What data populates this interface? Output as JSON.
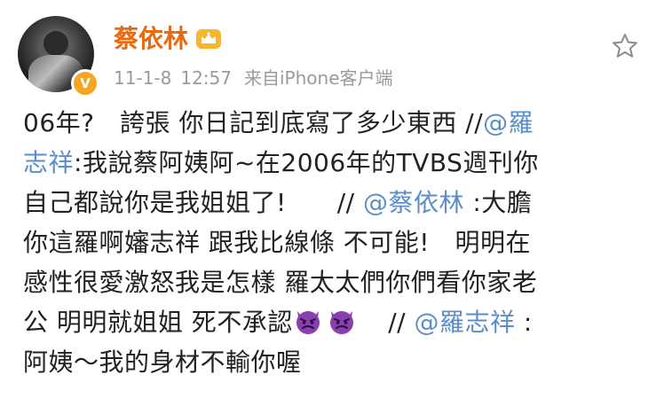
{
  "post": {
    "username": "蔡依林",
    "date": "11-1-8",
    "time": "12:57",
    "source": "来自iPhone客户端",
    "verified_badge": "V",
    "colors": {
      "username": "#e86b10",
      "mention": "#5b8ec9",
      "text": "#222222",
      "meta": "#9a9a9a",
      "badge": "#f5a623",
      "emoji_devil": "#8a3fb0"
    },
    "icons": [
      "crown-icon",
      "star-icon",
      "devil-emoji"
    ]
  },
  "content": {
    "line1_text": "06年?　誇張 你日記到底寫了多少東西 //",
    "mention1_part1": "@羅",
    "mention1_part2": "志祥",
    "line2_text": ":我說蔡阿姨阿~在2006年的TVBS週刊你",
    "line3_text": "自己都說你是我姐姐了!　　//",
    "mention2": "@蔡依林",
    "line3_after": ":大膽",
    "line4_text": "你這羅啊嬸志祥 跟我比線條 不可能!　明明在",
    "line5_text": "感性很愛激怒我是怎樣 羅太太們你們看你家老",
    "line6_text": "公 明明就姐姐 死不承認",
    "line6_sep": "//",
    "mention3": "@羅志祥",
    "line6_after": ":",
    "line7_text": "阿姨～我的身材不輸你喔"
  }
}
